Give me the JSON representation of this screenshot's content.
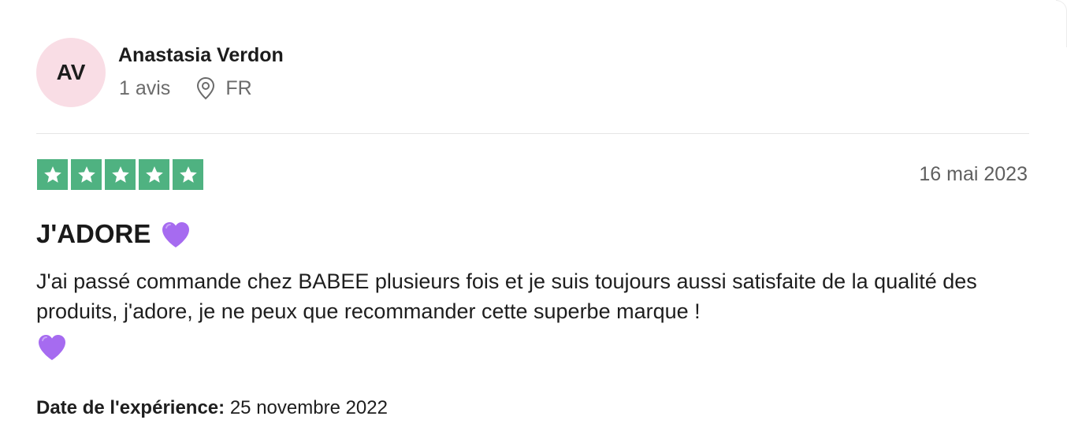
{
  "reviewer": {
    "initials": "AV",
    "name": "Anastasia Verdon",
    "review_count": "1 avis",
    "country": "FR"
  },
  "review": {
    "rating": 5,
    "date": "16 mai 2023",
    "title": "J'ADORE",
    "body": "J'ai passé commande chez BABEE plusieurs fois et je suis toujours aussi satisfaite de la qualité des produits, j'adore, je ne peux que recommander cette superbe marque !",
    "experience_label": "Date de l'expérience:",
    "experience_date": "25 novembre 2022"
  },
  "colors": {
    "star_green": "#4fb281",
    "avatar_pink": "#f9dde5",
    "heart_purple": "#a66bf0"
  },
  "icons": {
    "location": "location-pin-icon",
    "star": "star-icon",
    "heart": "purple-heart-icon"
  }
}
